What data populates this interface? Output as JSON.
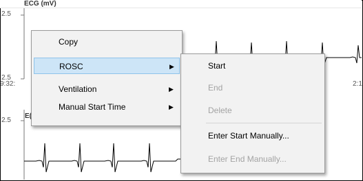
{
  "chart": {
    "title": "ECG (mV)",
    "tick_top": "2.5",
    "tick_mid": "2.5",
    "time_left": "9:32:",
    "time_right": "2:1",
    "tick_bottom": "2.5",
    "lead_label": "E("
  },
  "context_menu": {
    "items": [
      {
        "label": "Copy",
        "has_submenu": false
      },
      {
        "label": "ROSC",
        "has_submenu": true
      },
      {
        "label": "Ventilation",
        "has_submenu": true
      },
      {
        "label": "Manual Start Time",
        "has_submenu": true
      }
    ]
  },
  "submenu": {
    "items": [
      {
        "label": "Start",
        "enabled": true
      },
      {
        "label": "End",
        "enabled": false
      },
      {
        "label": "Delete",
        "enabled": false
      },
      {
        "label": "Enter Start Manually...",
        "enabled": true
      },
      {
        "label": "Enter End Manually...",
        "enabled": false
      }
    ]
  },
  "colors": {
    "menu_bg": "#f2f2f2",
    "highlight": "#cde5f7",
    "highlight_border": "#8ec3ea",
    "disabled_text": "#a3a3a3",
    "trace": "#000000"
  }
}
